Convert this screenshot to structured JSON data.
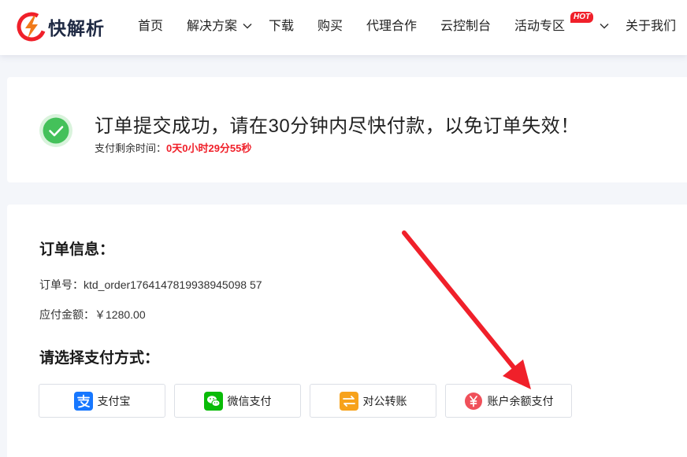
{
  "brand": {
    "name": "快解析",
    "accent": "#f0202a"
  },
  "nav": {
    "items": [
      {
        "label": "首页"
      },
      {
        "label": "解决方案"
      },
      {
        "label": "下载"
      },
      {
        "label": "购买"
      },
      {
        "label": "代理合作"
      },
      {
        "label": "云控制台"
      },
      {
        "label": "活动专区"
      },
      {
        "label": "关于我们"
      }
    ],
    "hot_badge": "HOT"
  },
  "success": {
    "title": "订单提交成功，请在30分钟内尽快付款，以免订单失效！",
    "countdown_label": "支付剩余时间：",
    "countdown_value": "0天0小时29分55秒"
  },
  "order": {
    "section_title": "订单信息：",
    "order_no_label": "订单号：",
    "order_no": "ktd_order1764147819938945098 57",
    "amount_label": "应付金额：",
    "amount": "￥1280.00"
  },
  "payment": {
    "section_title": "请选择支付方式：",
    "methods": [
      {
        "label": "支付宝",
        "icon": "alipay-icon",
        "color": "#1677ff"
      },
      {
        "label": "微信支付",
        "icon": "wechat-icon",
        "color": "#09bb07"
      },
      {
        "label": "对公转账",
        "icon": "transfer-icon",
        "color": "#f7a21b"
      },
      {
        "label": "账户余额支付",
        "icon": "yuan-icon",
        "color": "#f0505a"
      }
    ]
  }
}
